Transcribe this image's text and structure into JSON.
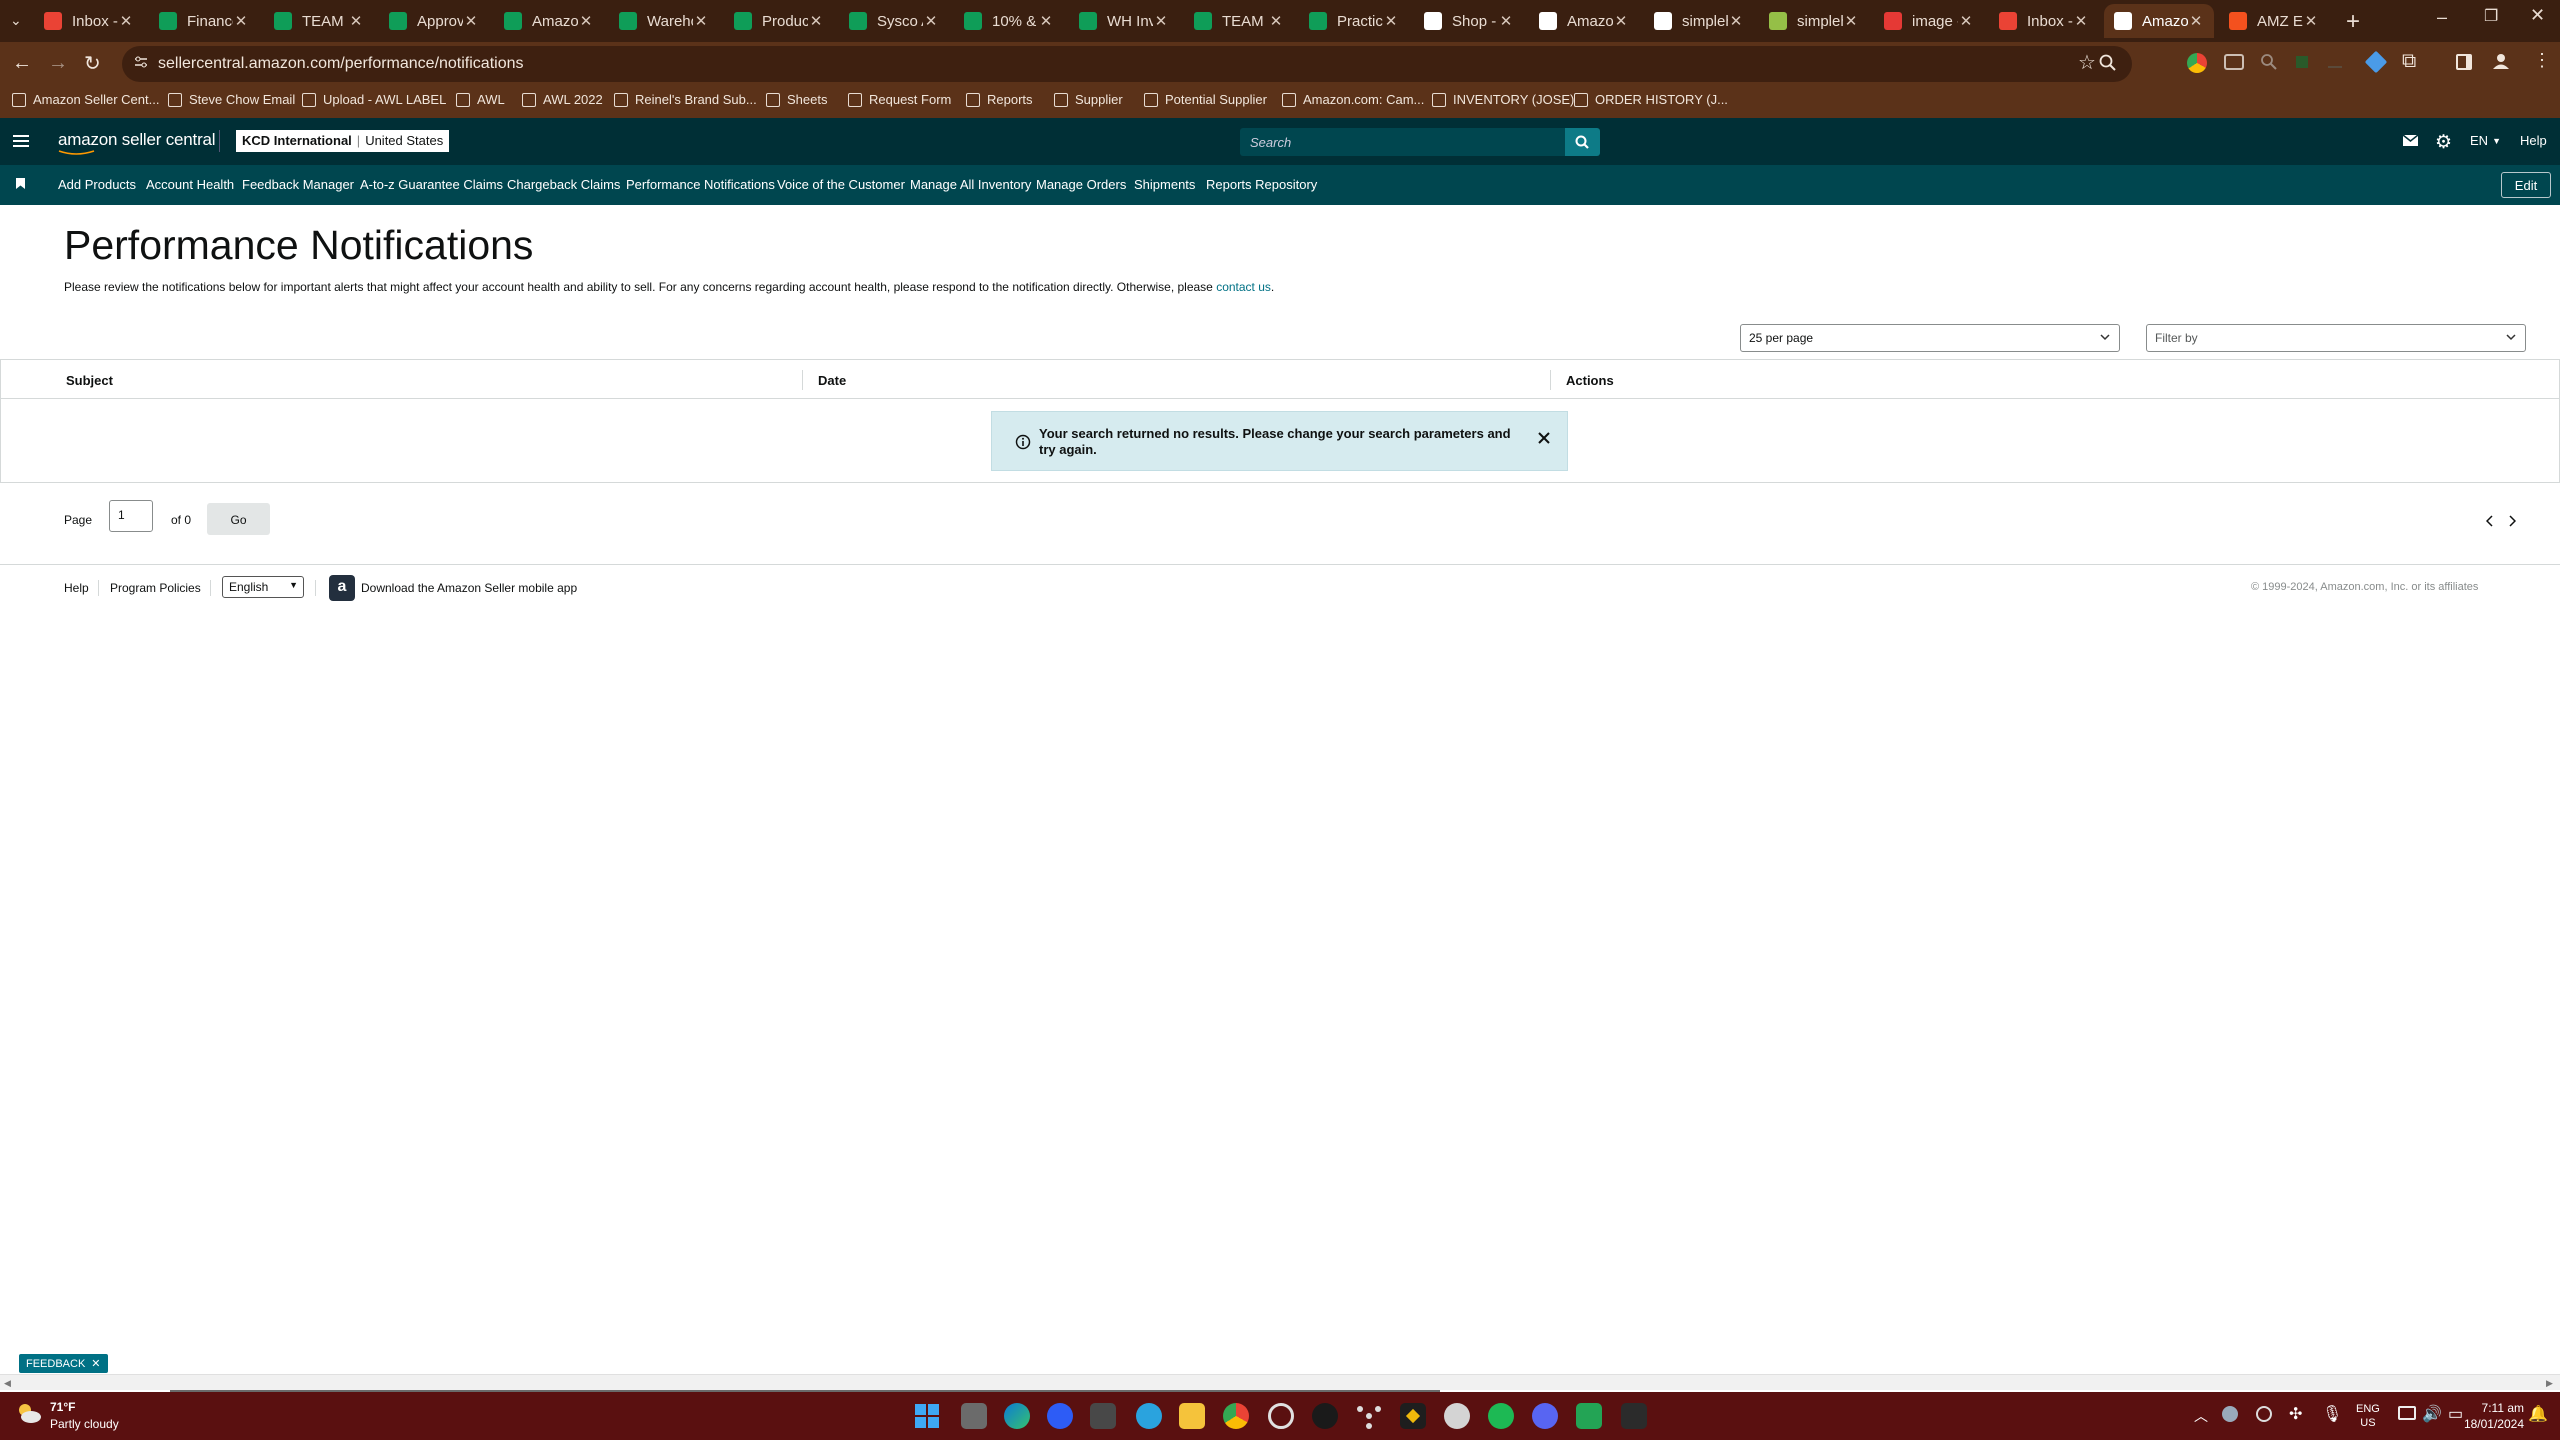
{
  "browser": {
    "tabs": [
      {
        "title": "Inbox - ",
        "icon": "gmail-icon",
        "color": "#ea4335"
      },
      {
        "title": "Finance",
        "icon": "sheets-icon",
        "color": "#0f9d58"
      },
      {
        "title": "TEAM K",
        "icon": "sheets-icon",
        "color": "#0f9d58"
      },
      {
        "title": "Approv",
        "icon": "sheets-icon",
        "color": "#0f9d58"
      },
      {
        "title": "Amazon",
        "icon": "sheets-icon",
        "color": "#0f9d58"
      },
      {
        "title": "Wareho",
        "icon": "sheets-icon",
        "color": "#0f9d58"
      },
      {
        "title": "Product",
        "icon": "sheets-icon",
        "color": "#0f9d58"
      },
      {
        "title": "Sysco A",
        "icon": "sheets-icon",
        "color": "#0f9d58"
      },
      {
        "title": "10% & ",
        "icon": "sheets-icon",
        "color": "#0f9d58"
      },
      {
        "title": "WH Inv",
        "icon": "sheets-icon",
        "color": "#0f9d58"
      },
      {
        "title": "TEAM K",
        "icon": "sheets-icon",
        "color": "#0f9d58"
      },
      {
        "title": "Practice",
        "icon": "sheets-icon",
        "color": "#0f9d58"
      },
      {
        "title": "Shop - ",
        "icon": "shopify-icon",
        "color": "#ffffff"
      },
      {
        "title": "Amazon",
        "icon": "amazon-icon",
        "color": "#ffffff"
      },
      {
        "title": "simpleh",
        "icon": "google-icon",
        "color": "#ffffff"
      },
      {
        "title": "simpleh",
        "icon": "simple-icon",
        "color": "#95bf47"
      },
      {
        "title": "image - ",
        "icon": "image-icon",
        "color": "#e53935"
      },
      {
        "title": "Inbox - ",
        "icon": "gmail-icon",
        "color": "#ea4335"
      },
      {
        "title": "Amazon",
        "icon": "amazon-icon",
        "color": "#ffffff",
        "active": true
      },
      {
        "title": "AMZ EC",
        "icon": "amz-ec-icon",
        "color": "#f4511e"
      }
    ],
    "url": "sellercentral.amazon.com/performance/notifications",
    "bookmarks": [
      {
        "label": "Amazon Seller Cent..."
      },
      {
        "label": "Steve Chow Email"
      },
      {
        "label": "Upload - AWL LABEL"
      },
      {
        "label": "AWL"
      },
      {
        "label": "AWL 2022"
      },
      {
        "label": "Reinel's Brand Sub..."
      },
      {
        "label": "Sheets"
      },
      {
        "label": "Request Form"
      },
      {
        "label": "Reports"
      },
      {
        "label": "Supplier"
      },
      {
        "label": "Potential Supplier"
      },
      {
        "label": "Amazon.com: Cam..."
      },
      {
        "label": "INVENTORY (JOSE)"
      },
      {
        "label": "ORDER HISTORY (J..."
      }
    ]
  },
  "seller_central": {
    "logo": "amazon seller central",
    "store_name": "KCD International",
    "marketplace": "United States",
    "search_placeholder": "Search",
    "language": "EN",
    "help": "Help",
    "edit": "Edit",
    "nav": [
      "Add Products",
      "Account Health",
      "Feedback Manager",
      "A-to-z Guarantee Claims",
      "Chargeback Claims",
      "Performance Notifications",
      "Voice of the Customer",
      "Manage All Inventory",
      "Manage Orders",
      "Shipments",
      "Reports Repository"
    ]
  },
  "content": {
    "title": "Performance Notifications",
    "intro": "Please review the notifications below for important alerts that might affect your account health and ability to sell. For any concerns regarding account health, please respond to the notification directly. Otherwise, please",
    "contact_link": "contact us",
    "intro_end": ".",
    "per_page": "25 per page",
    "filter_placeholder": "Filter by",
    "columns": [
      "Subject",
      "Date",
      "Actions"
    ],
    "alert": "Your search returned no results. Please change your search parameters and try again.",
    "pager": {
      "label": "Page",
      "value": "1",
      "of": "of 0",
      "go": "Go"
    }
  },
  "footer": {
    "help": "Help",
    "policies": "Program Policies",
    "language": "English",
    "app": "Download the Amazon Seller mobile app",
    "copyright": "© 1999-2024, Amazon.com, Inc. or its affiliates"
  },
  "feedback": "FEEDBACK",
  "taskbar": {
    "weather_temp": "71°F",
    "weather_desc": "Partly cloudy",
    "lang_line1": "ENG",
    "lang_line2": "US",
    "time": "7:11 am",
    "date": "18/01/2024"
  }
}
